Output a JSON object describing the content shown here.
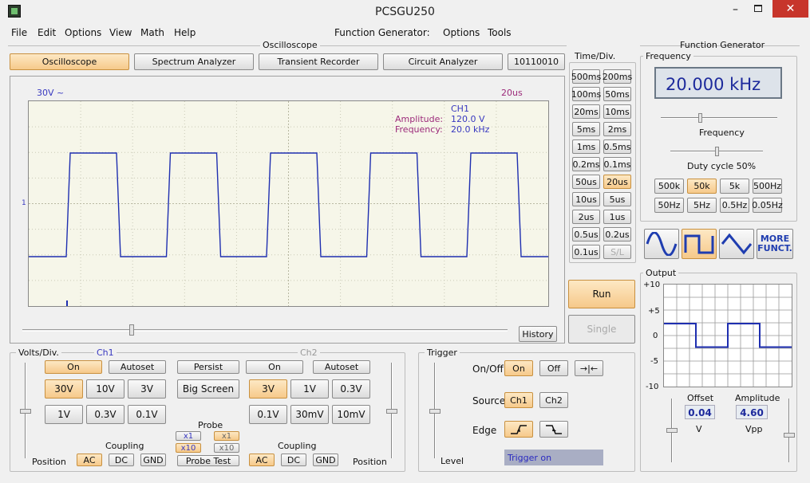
{
  "window": {
    "title": "PCSGU250"
  },
  "menu": [
    "File",
    "Edit",
    "Options",
    "View",
    "Math",
    "Help"
  ],
  "menu_fg": {
    "label": "Function Generator:",
    "options": "Options",
    "tools": "Tools"
  },
  "osc": {
    "group_title": "Oscilloscope",
    "tabs": [
      "Oscilloscope",
      "Spectrum Analyzer",
      "Transient Recorder",
      "Circuit Analyzer",
      "10110010"
    ],
    "active_tab": 0,
    "screen": {
      "volts": "30V ~",
      "time": "20us",
      "ch": "CH1",
      "amp_label": "Amplitude:",
      "amp_value": "120.0 V",
      "freq_label": "Frequency:",
      "freq_value": "20.0 kHz",
      "marker": "1"
    },
    "history": "History"
  },
  "timediv": {
    "title": "Time/Div.",
    "buttons": [
      "500ms",
      "200ms",
      "100ms",
      "50ms",
      "20ms",
      "10ms",
      "5ms",
      "2ms",
      "1ms",
      "0.5ms",
      "0.2ms",
      "0.1ms",
      "50us",
      "20us",
      "10us",
      "5us",
      "2us",
      "1us",
      "0.5us",
      "0.2us",
      "0.1us",
      "S/L"
    ],
    "selected": "20us",
    "disabled": "S/L"
  },
  "run": "Run",
  "single": "Single",
  "volts": {
    "title": "Volts/Div.",
    "ch1": "Ch1",
    "ch2": "Ch2",
    "on": "On",
    "autoset": "Autoset",
    "persist": "Persist",
    "big_screen": "Big Screen",
    "ch1_range": [
      "30V",
      "10V",
      "3V",
      "1V",
      "0.3V",
      "0.1V"
    ],
    "ch1_selected": "30V",
    "ch2_range": [
      "3V",
      "1V",
      "0.3V",
      "0.1V",
      "30mV",
      "10mV"
    ],
    "ch2_selected": "3V",
    "probe": "Probe",
    "x1": "x1",
    "x10": "x10",
    "probe_test": "Probe Test",
    "coupling": "Coupling",
    "ac": "AC",
    "dc": "DC",
    "gnd": "GND",
    "position": "Position"
  },
  "trigger": {
    "title": "Trigger",
    "onoff": "On/Off",
    "on": "On",
    "off": "Off",
    "source": "Source",
    "ch1": "Ch1",
    "ch2": "Ch2",
    "edge": "Edge",
    "level": "Level",
    "status": "Trigger on"
  },
  "fg": {
    "title": "Function Generator",
    "freq_group": "Frequency",
    "freq_display": "20.000 kHz",
    "freq_label": "Frequency",
    "duty": "Duty cycle 50%",
    "range": [
      "500k",
      "50k",
      "5k",
      "500Hz",
      "50Hz",
      "5Hz",
      "0.5Hz",
      "0.05Hz"
    ],
    "range_selected": "50k",
    "more": "MORE FUNCT.",
    "output": "Output",
    "yticks": [
      "+10",
      "+5",
      "0",
      "-5",
      "-10"
    ],
    "offset_label": "Offset",
    "offset_value": "0.04",
    "offset_unit": "V",
    "amp_label": "Amplitude",
    "amp_value": "4.60",
    "amp_unit": "Vpp"
  },
  "colors": {
    "trace": "#1f2fb0",
    "screen_bg": "#f6f6e9",
    "selected": "#f6c98a",
    "accent_text": "#3838c0"
  }
}
